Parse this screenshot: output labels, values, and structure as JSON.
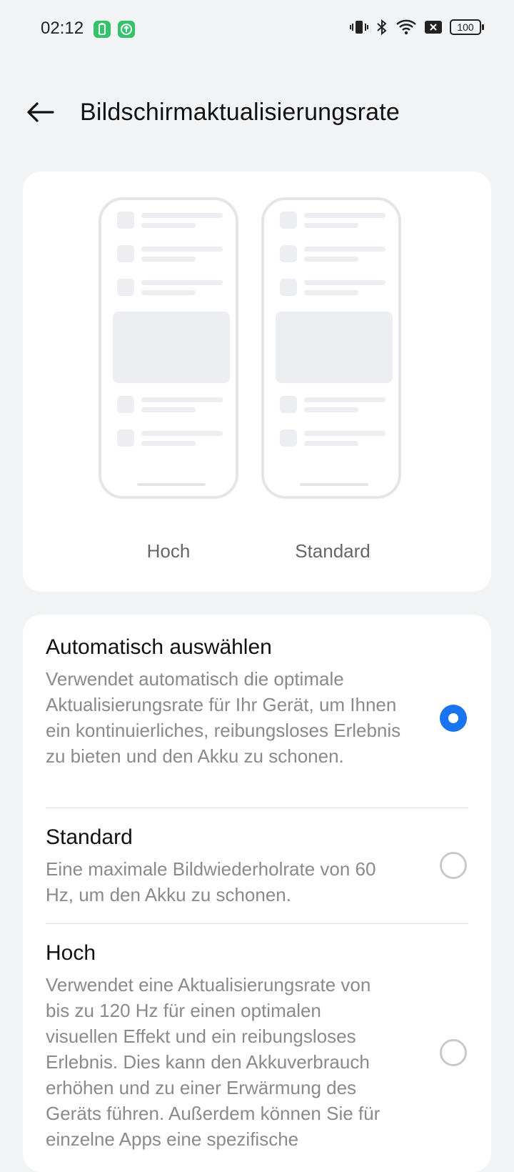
{
  "status_bar": {
    "time": "02:12",
    "left_icons": [
      "battery-saver-icon",
      "upload-icon"
    ],
    "right_icons": [
      "vibrate-icon",
      "bluetooth-icon",
      "wifi-icon",
      "no-sim-icon",
      "battery-icon"
    ],
    "battery_level": "100"
  },
  "header": {
    "back_icon": "arrow-left-icon",
    "title": "Bildschirmaktualisierungsrate"
  },
  "preview": {
    "phones": [
      {
        "label": "Hoch"
      },
      {
        "label": "Standard"
      }
    ]
  },
  "options": [
    {
      "title": "Automatisch auswählen",
      "description": "Verwendet automatisch die optimale Aktualisierungsrate für Ihr Gerät, um Ihnen ein kontinuierliches, reibungsloses Erlebnis zu bieten und den Akku zu schonen.",
      "selected": true
    },
    {
      "title": "Standard",
      "description": "Eine maximale Bildwiederholrate von 60 Hz, um den Akku zu schonen.",
      "selected": false
    },
    {
      "title": "Hoch",
      "description": "Verwendet eine Aktualisierungsrate von bis zu 120 Hz für einen optimalen visuellen Effekt und ein reibungsloses Erlebnis. Dies kann den Akkuverbrauch erhöhen und zu einer Erwärmung des Geräts führen. Außerdem können Sie für einzelne Apps eine spezifische",
      "selected": false
    }
  ],
  "colors": {
    "accent": "#1a73f0",
    "background": "#f2f3f5",
    "card": "#ffffff",
    "status_icon_green": "#34c26b"
  }
}
